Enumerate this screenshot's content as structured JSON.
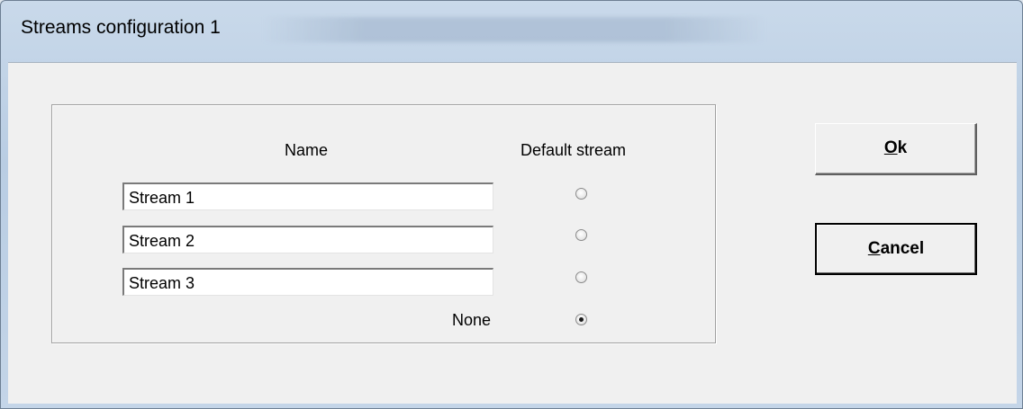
{
  "window": {
    "title": "Streams configuration 1"
  },
  "table": {
    "name_header": "Name",
    "default_header": "Default stream",
    "rows": [
      {
        "value": "Stream 1",
        "selected": false
      },
      {
        "value": "Stream 2",
        "selected": false
      },
      {
        "value": "Stream 3",
        "selected": false
      }
    ],
    "none_label": "None",
    "none_selected": true
  },
  "buttons": {
    "ok_mnemonic": "O",
    "ok_rest": "k",
    "cancel_mnemonic": "C",
    "cancel_rest": "ancel"
  }
}
